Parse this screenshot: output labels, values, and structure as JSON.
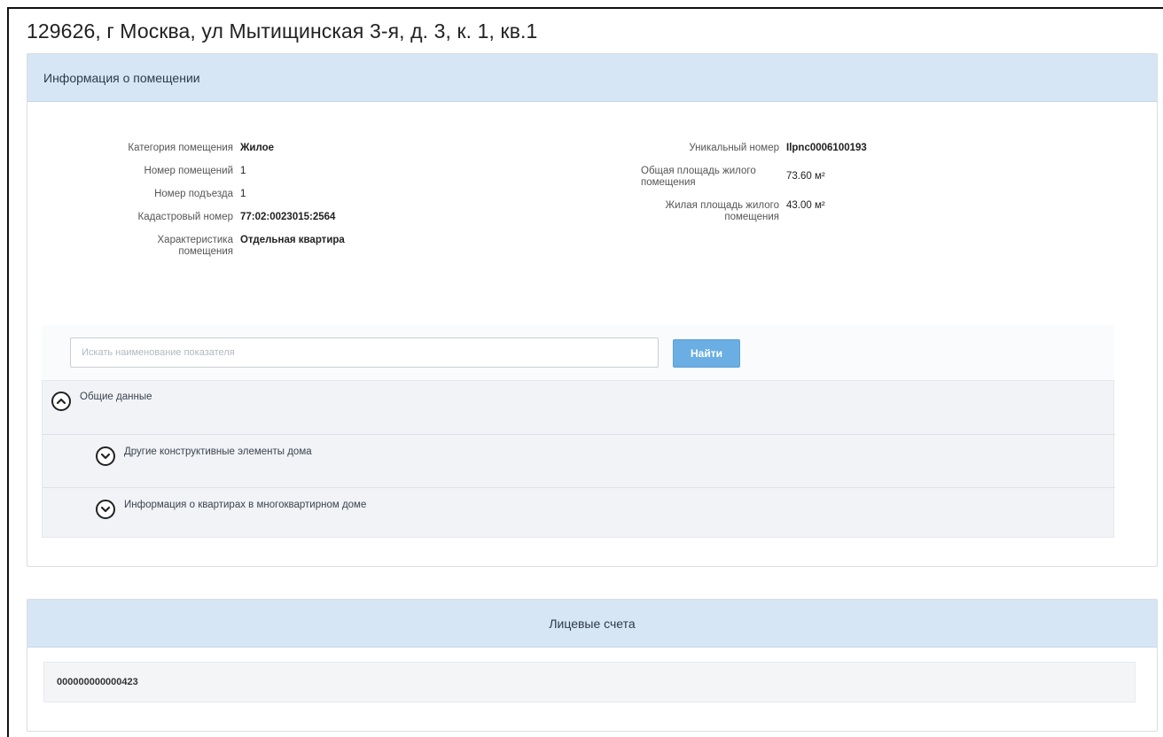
{
  "page": {
    "title": "129626, г Москва, ул Мытищинская 3-я, д. 3, к. 1, кв.1"
  },
  "info_panel": {
    "header": "Информация о помещении",
    "left_fields": [
      {
        "label": "Категория помещения",
        "value": "Жилое"
      },
      {
        "label": "Номер помещений",
        "value": "1"
      },
      {
        "label": "Номер подъезда",
        "value": "1"
      },
      {
        "label": "Кадастровый номер",
        "value": "77:02:0023015:2564"
      },
      {
        "label": "Характеристика помещения",
        "value": "Отдельная квартира"
      }
    ],
    "right_fields": [
      {
        "label": "Уникальный номер",
        "value": "Ilpnc0006100193"
      },
      {
        "label": "Общая площадь жилого помещения",
        "value": "73.60 м²"
      },
      {
        "label": "Жилая площадь жилого помещения",
        "value": "43.00 м²"
      }
    ],
    "search": {
      "placeholder": "Искать наименование показателя",
      "button_label": "Найти"
    },
    "accordion": [
      {
        "label": "Общие данные",
        "state": "expanded"
      },
      {
        "label": "Другие конструктивные элементы дома",
        "state": "collapsed"
      },
      {
        "label": "Информация о квартирах в многоквартирном доме",
        "state": "collapsed"
      }
    ]
  },
  "accounts_panel": {
    "header": "Лицевые счета",
    "accounts": [
      "000000000000423"
    ]
  },
  "colors": {
    "header_bg": "#d6e6f5",
    "button_bg": "#6aaee3"
  }
}
